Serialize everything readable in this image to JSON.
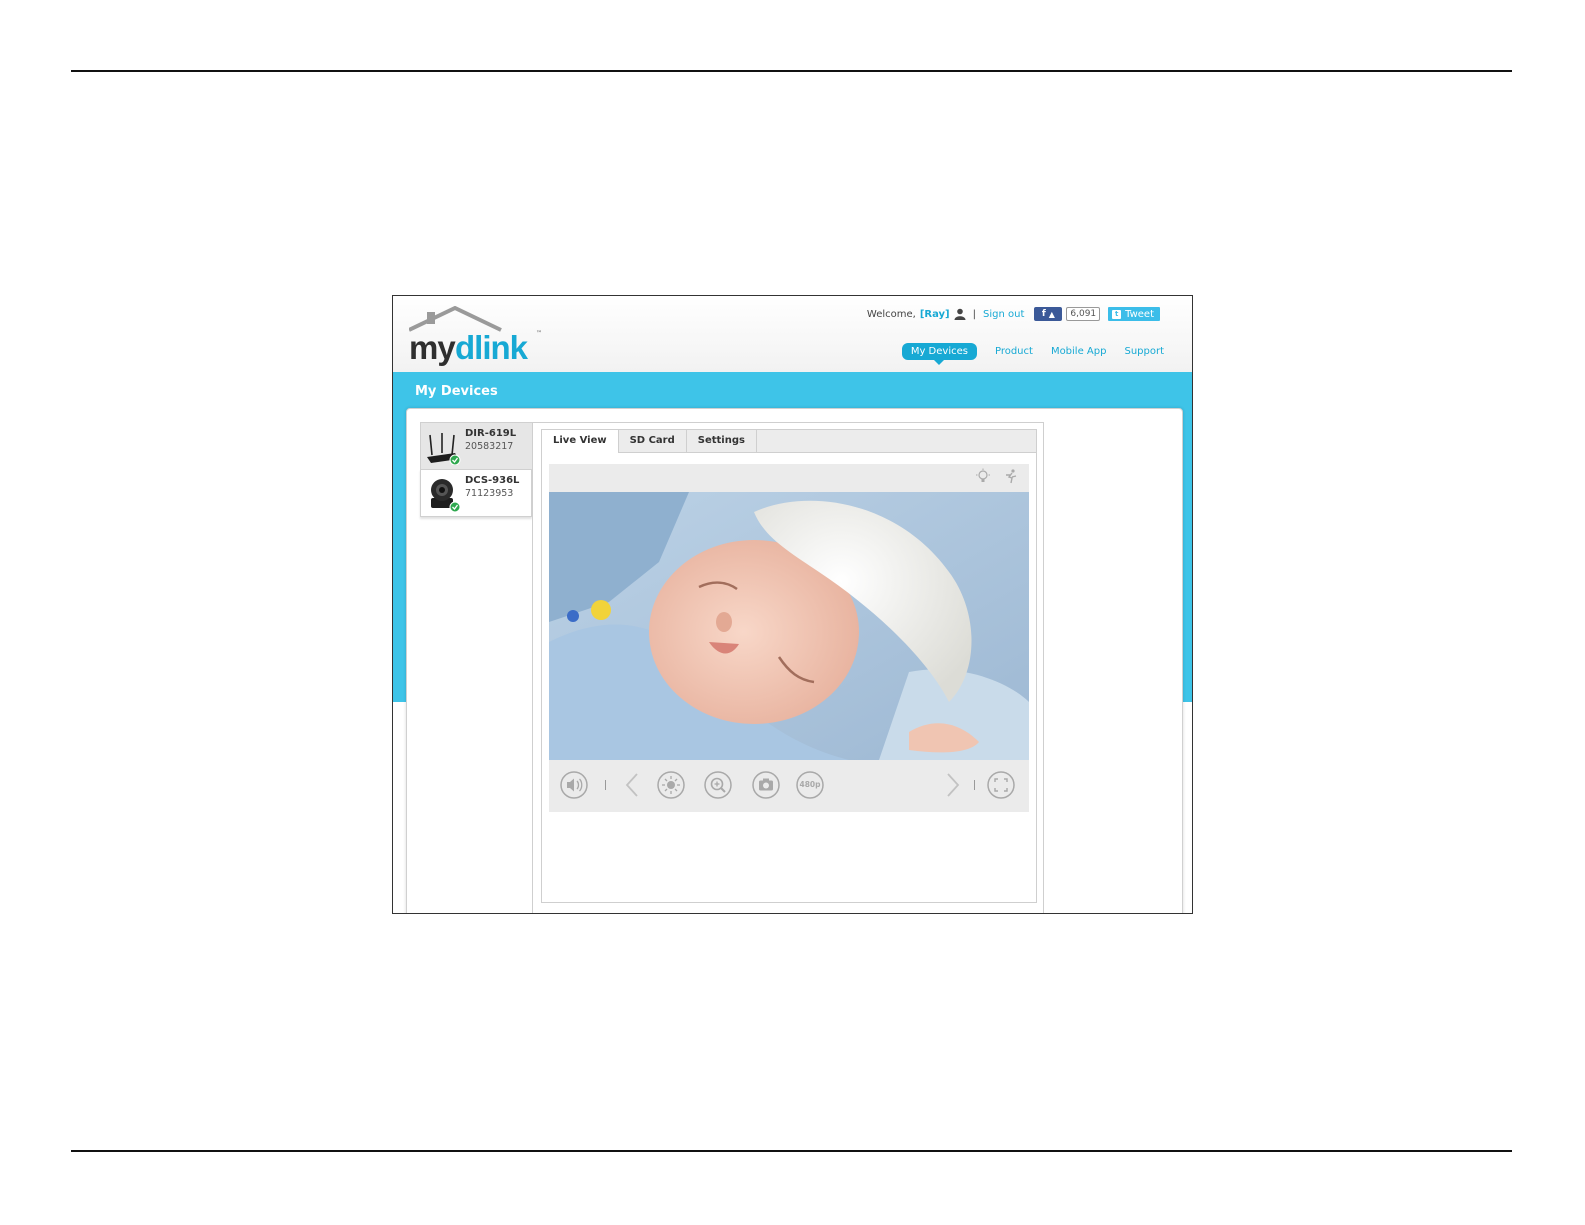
{
  "header": {
    "welcome": "Welcome,",
    "user": "[Ray]",
    "separator": "|",
    "signout": "Sign out",
    "fb_label": "f",
    "fb_count": "6,091",
    "tweet_label": "Tweet"
  },
  "logo": {
    "my": "my",
    "dlink": "dlink",
    "tm": "™"
  },
  "nav": {
    "items": [
      {
        "label": "My Devices",
        "active": true
      },
      {
        "label": "Product"
      },
      {
        "label": "Mobile App"
      },
      {
        "label": "Support"
      }
    ]
  },
  "band": {
    "title": "My Devices"
  },
  "devices": [
    {
      "name": "DIR-619L",
      "serial": "20583217",
      "selected": true,
      "icon": "router-icon"
    },
    {
      "name": "DCS-936L",
      "serial": "71123953",
      "selected": false,
      "icon": "camera-icon"
    }
  ],
  "tabs": [
    {
      "label": "Live View",
      "active": true
    },
    {
      "label": "SD Card"
    },
    {
      "label": "Settings"
    }
  ],
  "controls": {
    "resolution": "480p",
    "icons": [
      "speaker-icon",
      "prev-icon",
      "brightness-icon",
      "zoom-icon",
      "snapshot-icon",
      "resolution-icon",
      "next-icon",
      "fullscreen-icon"
    ]
  },
  "colors": {
    "accent": "#17a9d4",
    "band": "#3ec4e8",
    "facebook": "#3b5998",
    "twitter": "#3bbde9"
  }
}
